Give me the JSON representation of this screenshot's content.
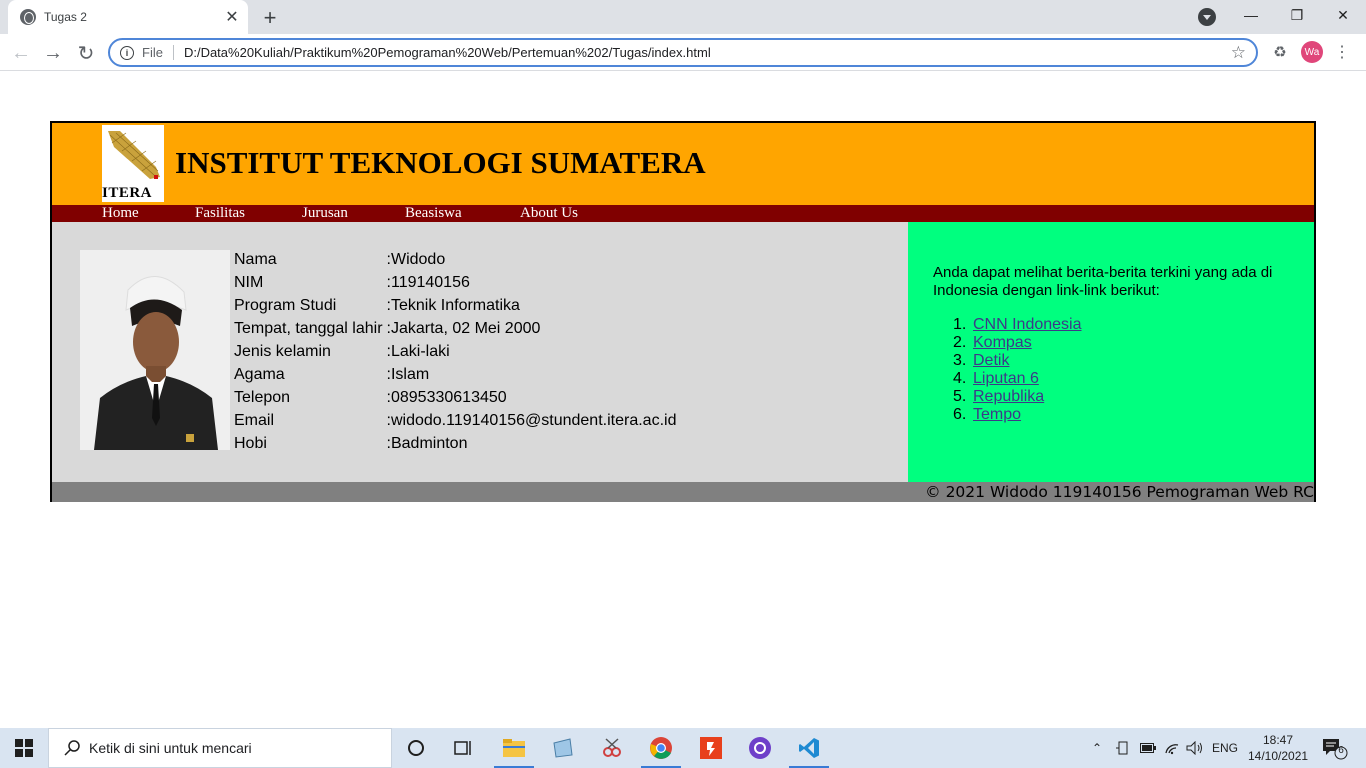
{
  "browser": {
    "tab_title": "Tugas 2",
    "tab_close": "✕",
    "new_tab": "+",
    "scheme": "File",
    "url": "D:/Data%20Kuliah/Praktikum%20Pemograman%20Web/Pertemuan%202/Tugas/index.html",
    "profile_initials": "Wa"
  },
  "site": {
    "logo_text": "ITERA",
    "title": "INSTITUT TEKNOLOGI SUMATERA",
    "nav": [
      "Home",
      "Fasilitas",
      "Jurusan",
      "Beasiswa",
      "About Us"
    ]
  },
  "bio": [
    {
      "label": "Nama",
      "value": ":Widodo"
    },
    {
      "label": "NIM",
      "value": ":119140156"
    },
    {
      "label": "Program Studi",
      "value": ":Teknik Informatika"
    },
    {
      "label": "Tempat, tanggal lahir",
      "value": ":Jakarta, 02 Mei 2000"
    },
    {
      "label": "Jenis kelamin",
      "value": ":Laki-laki"
    },
    {
      "label": "Agama",
      "value": ":Islam"
    },
    {
      "label": "Telepon",
      "value": ":0895330613450"
    },
    {
      "label": "Email",
      "value": ":widodo.119140156@stundent.itera.ac.id"
    },
    {
      "label": "Hobi",
      "value": ":Badminton"
    }
  ],
  "aside": {
    "intro": "Anda dapat melihat berita-berita terkini yang ada di Indonesia dengan link-link berikut:",
    "links": [
      {
        "num": "1.",
        "label": "CNN Indonesia"
      },
      {
        "num": "2.",
        "label": "Kompas"
      },
      {
        "num": "3.",
        "label": "Detik"
      },
      {
        "num": "4.",
        "label": "Liputan 6"
      },
      {
        "num": "5.",
        "label": "Republika"
      },
      {
        "num": "6.",
        "label": "Tempo"
      }
    ]
  },
  "footer": {
    "text": "© 2021 Widodo 119140156 Pemograman Web RC"
  },
  "taskbar": {
    "search_placeholder": "Ketik di sini untuk mencari",
    "language": "ENG",
    "time": "18:47",
    "date": "14/10/2021",
    "notification_count": "6"
  },
  "colors": {
    "header": "#ffa500",
    "navbar": "#800000",
    "main": "#d9d9d9",
    "aside": "#00ff7f",
    "footer": "#808080",
    "link": "#3c3a88"
  }
}
